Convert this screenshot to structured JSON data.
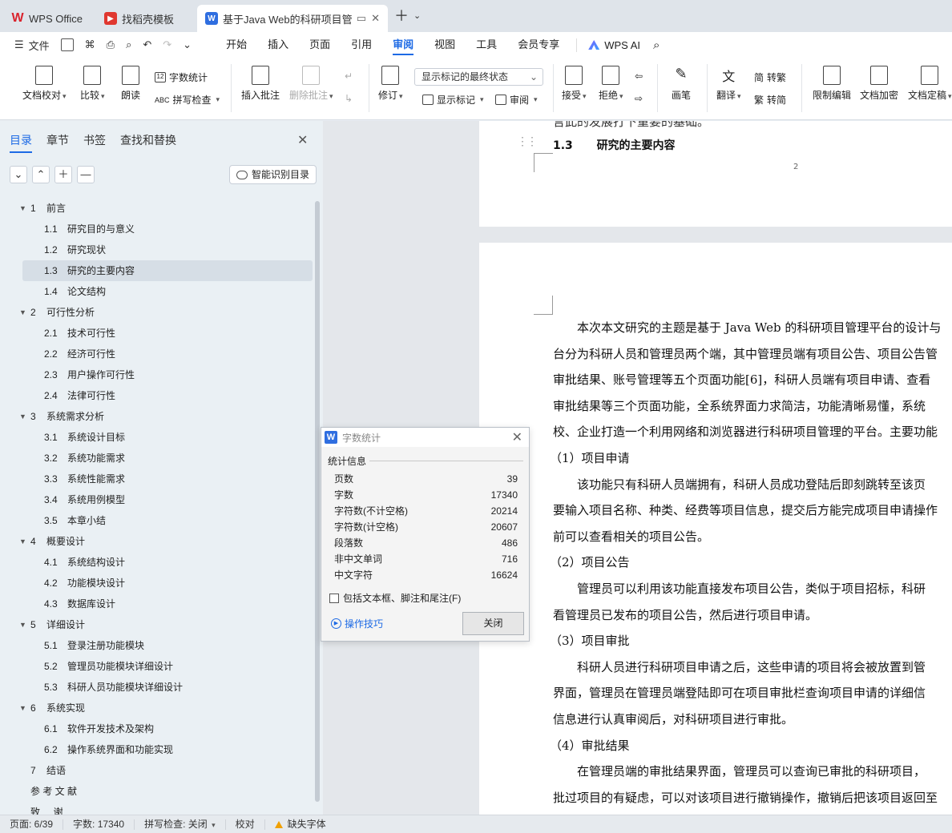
{
  "tabs": [
    {
      "label": "WPS Office",
      "icon": "wps-logo-icon"
    },
    {
      "label": "找稻壳模板",
      "icon": "docer-icon"
    },
    {
      "label": "基于Java Web的科研项目管理",
      "icon": "writer-icon",
      "active": true
    }
  ],
  "menu": {
    "file": "文件",
    "tabs": [
      "开始",
      "插入",
      "页面",
      "引用",
      "审阅",
      "视图",
      "工具",
      "会员专享"
    ],
    "active_tab": "审阅",
    "ai": "WPS AI"
  },
  "ribbon": {
    "proofread": "文档校对",
    "compare": "比较",
    "read_aloud": "朗读",
    "word_count": "字数统计",
    "spell_check": "拼写检查",
    "insert_comment": "插入批注",
    "delete_comment": "删除批注",
    "revise": "修订",
    "markup_state": "显示标记的最终状态",
    "show_markup": "显示标记",
    "review": "审阅",
    "accept": "接受",
    "reject": "拒绝",
    "pen": "画笔",
    "translate": "翻译",
    "to_trad": "转繁",
    "to_simp": "转简",
    "restrict_edit": "限制编辑",
    "encrypt": "文档加密",
    "finalize": "文档定稿"
  },
  "nav": {
    "tabs": [
      "目录",
      "章节",
      "书签",
      "查找和替换"
    ],
    "active_tab": "目录",
    "smart_toc": "智能识别目录",
    "items": [
      {
        "num": "1",
        "title": "前言",
        "level": 1,
        "expanded": true
      },
      {
        "num": "1.1",
        "title": "研究目的与意义",
        "level": 2
      },
      {
        "num": "1.2",
        "title": "研究现状",
        "level": 2
      },
      {
        "num": "1.3",
        "title": "研究的主要内容",
        "level": 2,
        "selected": true
      },
      {
        "num": "1.4",
        "title": "论文结构",
        "level": 2
      },
      {
        "num": "2",
        "title": "可行性分析",
        "level": 1,
        "expanded": true
      },
      {
        "num": "2.1",
        "title": "技术可行性",
        "level": 2
      },
      {
        "num": "2.2",
        "title": "经济可行性",
        "level": 2
      },
      {
        "num": "2.3",
        "title": "用户操作可行性",
        "level": 2
      },
      {
        "num": "2.4",
        "title": "法律可行性",
        "level": 2
      },
      {
        "num": "3",
        "title": "系统需求分析",
        "level": 1,
        "expanded": true
      },
      {
        "num": "3.1",
        "title": "系统设计目标",
        "level": 2
      },
      {
        "num": "3.2",
        "title": "系统功能需求",
        "level": 2
      },
      {
        "num": "3.3",
        "title": "系统性能需求",
        "level": 2
      },
      {
        "num": "3.4",
        "title": "系统用例模型",
        "level": 2
      },
      {
        "num": "3.5",
        "title": "本章小结",
        "level": 2
      },
      {
        "num": "4",
        "title": "概要设计",
        "level": 1,
        "expanded": true
      },
      {
        "num": "4.1",
        "title": "系统结构设计",
        "level": 2
      },
      {
        "num": "4.2",
        "title": "功能模块设计",
        "level": 2
      },
      {
        "num": "4.3",
        "title": "数据库设计",
        "level": 2
      },
      {
        "num": "5",
        "title": "详细设计",
        "level": 1,
        "expanded": true
      },
      {
        "num": "5.1",
        "title": "登录注册功能模块",
        "level": 2
      },
      {
        "num": "5.2",
        "title": "管理员功能模块详细设计",
        "level": 2
      },
      {
        "num": "5.3",
        "title": "科研人员功能模块详细设计",
        "level": 2
      },
      {
        "num": "6",
        "title": "系统实现",
        "level": 1,
        "expanded": true
      },
      {
        "num": "6.1",
        "title": "软件开发技术及架构",
        "level": 2
      },
      {
        "num": "6.2",
        "title": "操作系统界面和功能实现",
        "level": 2
      },
      {
        "num": "7",
        "title": "结语",
        "level": 1
      },
      {
        "num": "",
        "title": "参 考 文 献",
        "level": 1
      },
      {
        "num": "",
        "title": "致     谢",
        "level": 1
      }
    ]
  },
  "document": {
    "top_fragment": "言此的发展打下重要的基础。",
    "heading": {
      "num": "1.3",
      "title": "研究的主要内容"
    },
    "page_number": "2",
    "lines": [
      "本次本文研究的主题是基于 Java Web 的科研项目管理平台的设计与",
      "台分为科研人员和管理员两个端，其中管理员端有项目公告、项目公告管",
      "审批结果、账号管理等五个页面功能[6]，科研人员端有项目申请、查看",
      "审批结果等三个页面功能，全系统界面力求简洁，功能清晰易懂，系统",
      "校、企业打造一个利用网络和浏览器进行科研项目管理的平台。主要功能",
      "（1）项目申请",
      "该功能只有科研人员端拥有，科研人员成功登陆后即刻跳转至该页",
      "要输入项目名称、种类、经费等项目信息，提交后方能完成项目申请操作",
      "前可以查看相关的项目公告。",
      "（2）项目公告",
      "管理员可以利用该功能直接发布项目公告，类似于项目招标，科研",
      "看管理员已发布的项目公告，然后进行项目申请。",
      "（3）项目审批",
      "科研人员进行科研项目申请之后，这些申请的项目将会被放置到管",
      "界面，管理员在管理员端登陆即可在项目审批栏查询项目申请的详细信",
      "信息进行认真审阅后，对科研项目进行审批。",
      "（4）审批结果",
      "在管理员端的审批结果界面，管理员可以查询已审批的科研项目，",
      "批过项目的有疑虑，可以对该项目进行撤销操作，撤销后把该项目返回至"
    ]
  },
  "word_count_dialog": {
    "title": "字数统计",
    "section": "统计信息",
    "stats": [
      {
        "label": "页数",
        "value": "39"
      },
      {
        "label": "字数",
        "value": "17340"
      },
      {
        "label": "字符数(不计空格)",
        "value": "20214"
      },
      {
        "label": "字符数(计空格)",
        "value": "20607"
      },
      {
        "label": "段落数",
        "value": "486"
      },
      {
        "label": "非中文单词",
        "value": "716"
      },
      {
        "label": "中文字符",
        "value": "16624"
      }
    ],
    "include_label": "包括文本框、脚注和尾注(F)",
    "include_checked": false,
    "tips": "操作技巧",
    "close": "关闭"
  },
  "status": {
    "page": "页面: 6/39",
    "words": "字数: 17340",
    "spell": "拼写检查: 关闭",
    "proof": "校对",
    "missing_font": "缺失字体"
  },
  "colors": {
    "accent": "#1d6ae5",
    "wps_red": "#d9232d",
    "nav_bg": "#eaf0f4"
  }
}
